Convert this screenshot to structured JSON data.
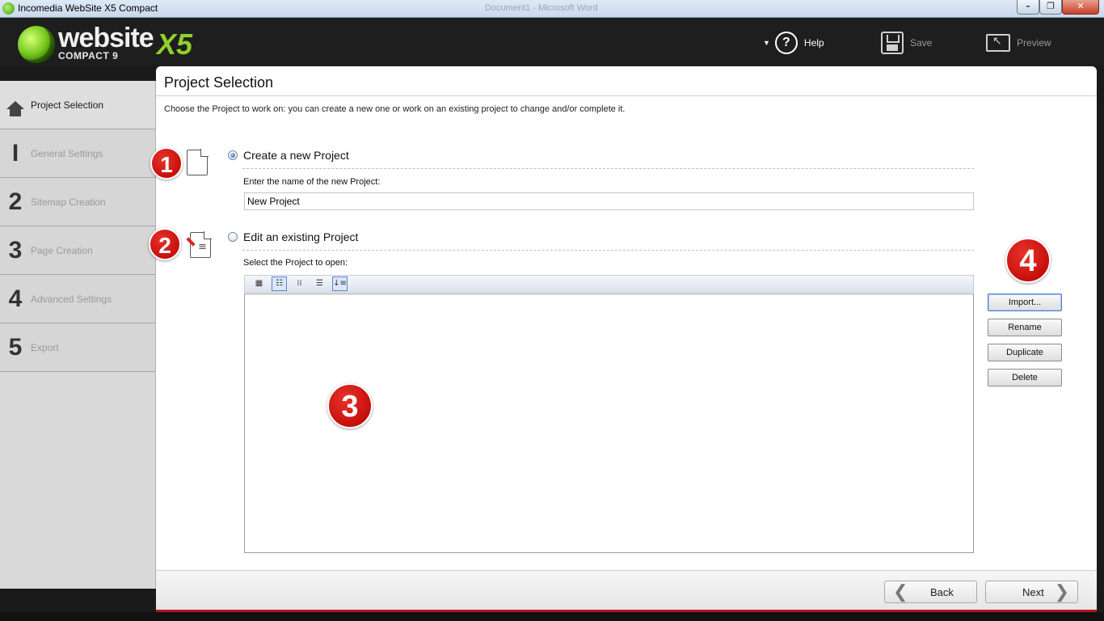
{
  "window": {
    "title": "Incomedia WebSite X5 Compact",
    "background_title": "Document1 - Microsoft Word",
    "minimize": "–",
    "maximize": "❐",
    "close": "✕"
  },
  "header": {
    "logo_word": "website",
    "logo_x5": "X5",
    "logo_sub": "COMPACT 9",
    "help_label": "Help",
    "save_label": "Save",
    "preview_label": "Preview"
  },
  "sidebar": {
    "items": [
      {
        "num": "",
        "label": "Project Selection",
        "active": true,
        "icon": "home-icon"
      },
      {
        "num": "I",
        "label": "General Settings",
        "active": false
      },
      {
        "num": "2",
        "label": "Sitemap Creation",
        "active": false
      },
      {
        "num": "3",
        "label": "Page Creation",
        "active": false
      },
      {
        "num": "4",
        "label": "Advanced Settings",
        "active": false
      },
      {
        "num": "5",
        "label": "Export",
        "active": false
      }
    ]
  },
  "main": {
    "page_title": "Project Selection",
    "description": "Choose the Project to work on: you can create a new one or work on an existing project to change and/or complete it.",
    "new_project": {
      "option_label": "Create a new Project",
      "selected": true,
      "field_label": "Enter the name of the new Project:",
      "field_value": "New Project"
    },
    "existing_project": {
      "option_label": "Edit an existing Project",
      "selected": false,
      "field_label": "Select the Project to open:"
    },
    "list_toolbar": [
      {
        "icon": "large-icons-view-icon",
        "glyph": "▦",
        "on": false
      },
      {
        "icon": "tiles-view-icon",
        "glyph": "☷",
        "on": true
      },
      {
        "icon": "small-icons-view-icon",
        "glyph": "⁞⁞",
        "on": false
      },
      {
        "icon": "list-view-icon",
        "glyph": "☰",
        "on": false
      },
      {
        "icon": "sort-icon",
        "glyph": "↓≡",
        "on": true
      }
    ],
    "side_buttons": {
      "import": "Import...",
      "rename": "Rename",
      "duplicate": "Duplicate",
      "delete": "Delete"
    },
    "badges": {
      "one": "1",
      "two": "2",
      "three": "3",
      "four": "4"
    },
    "back_label": "Back",
    "next_label": "Next"
  },
  "colors": {
    "accent_green": "#8fcf2e",
    "badge_red": "#cc1a12",
    "header_bg": "#1e1e1e"
  }
}
